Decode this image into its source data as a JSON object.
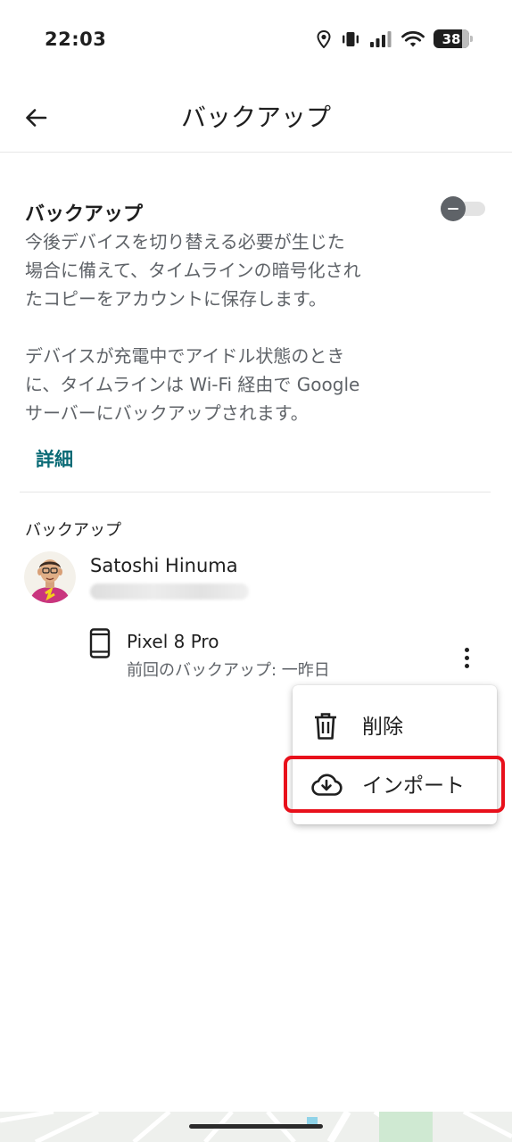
{
  "status_bar": {
    "time": "22:03",
    "battery": "38",
    "icons": [
      "location-icon",
      "vibrate-icon",
      "signal-icon",
      "wifi-icon",
      "battery-icon"
    ]
  },
  "app_bar": {
    "back_icon": "arrow-back-icon",
    "title": "バックアップ"
  },
  "backup_section": {
    "title": "バックアップ",
    "toggle_on": false,
    "description_lines_1": [
      "今後デバイスを切り替える必要が生じた",
      "場合に備えて、タイムラインの暗号化され",
      "たコピーをアカウントに保存します。"
    ],
    "description_lines_2": [
      "デバイスが充電中でアイドル状態のとき",
      "に、タイムラインは Wi-Fi 経由で Google",
      "サーバーにバックアップされます。"
    ],
    "details_link": "詳細"
  },
  "backups": {
    "label": "バックアップ",
    "account": {
      "name": "Satoshi Hinuma",
      "email_blurred": true
    },
    "device": {
      "icon": "smartphone-icon",
      "name": "Pixel 8 Pro",
      "last_backup": "前回のバックアップ: 一昨日"
    }
  },
  "menu": {
    "items": [
      {
        "icon": "trash-icon",
        "label": "削除"
      },
      {
        "icon": "cloud-download-icon",
        "label": "インポート",
        "highlighted": true
      }
    ]
  },
  "colors": {
    "link": "#0b6b76",
    "highlight": "#e8101b",
    "secondary_text": "#5f6368"
  }
}
